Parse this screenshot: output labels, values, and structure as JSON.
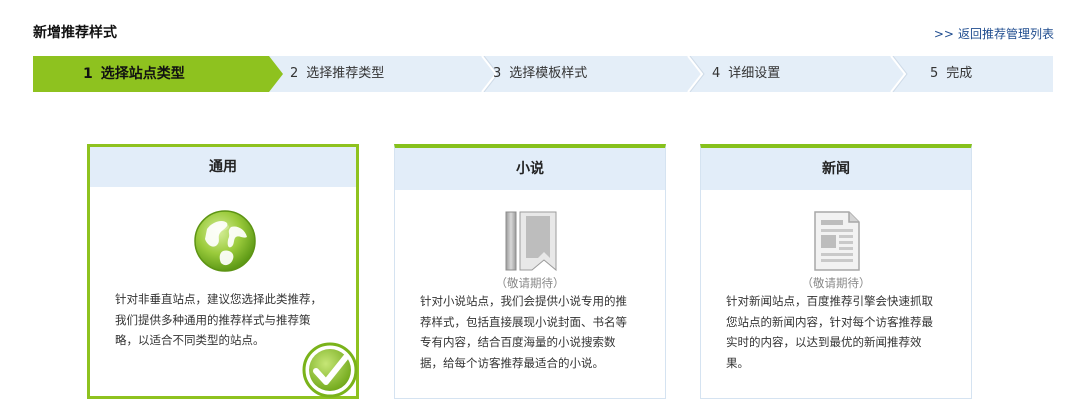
{
  "page": {
    "title": "新增推荐样式",
    "back_link": "返回推荐管理列表",
    "back_chevron": ">>"
  },
  "steps": [
    {
      "num": "1",
      "label": "选择站点类型",
      "active": true
    },
    {
      "num": "2",
      "label": "选择推荐类型",
      "active": false
    },
    {
      "num": "3",
      "label": "选择模板样式",
      "active": false
    },
    {
      "num": "4",
      "label": "详细设置",
      "active": false
    },
    {
      "num": "5",
      "label": "完成",
      "active": false
    }
  ],
  "cards": [
    {
      "title": "通用",
      "icon": "globe-icon",
      "description": [
        "针对非垂直站点，建议您选择此类推荐，",
        "我们提供多种通用的推荐样式与推荐策",
        "略，以适合不同类型的站点。"
      ],
      "selected": true
    },
    {
      "title": "小说",
      "icon": "book-icon",
      "status": "（敬请期待）",
      "description": [
        "针对小说站点，我们会提供小说专用的推",
        "荐样式，包括直接展现小说封面、书名等",
        "专有内容，结合百度海量的小说搜索数",
        "据，给每个访客推荐最适合的小说。"
      ],
      "selected": false
    },
    {
      "title": "新闻",
      "icon": "newspaper-icon",
      "status": "（敬请期待）",
      "description": [
        "针对新闻站点，百度推荐引擎会快速抓取",
        "您站点的新闻内容，针对每个访客推荐最",
        "实时的内容，以达到最优的新闻推荐效",
        "果。"
      ],
      "selected": false
    }
  ],
  "colors": {
    "accent_green": "#8ec21f",
    "stepper_bg": "#e4eef8",
    "card_head_bg": "#e2edf9",
    "link_blue": "#1f4c8f"
  }
}
